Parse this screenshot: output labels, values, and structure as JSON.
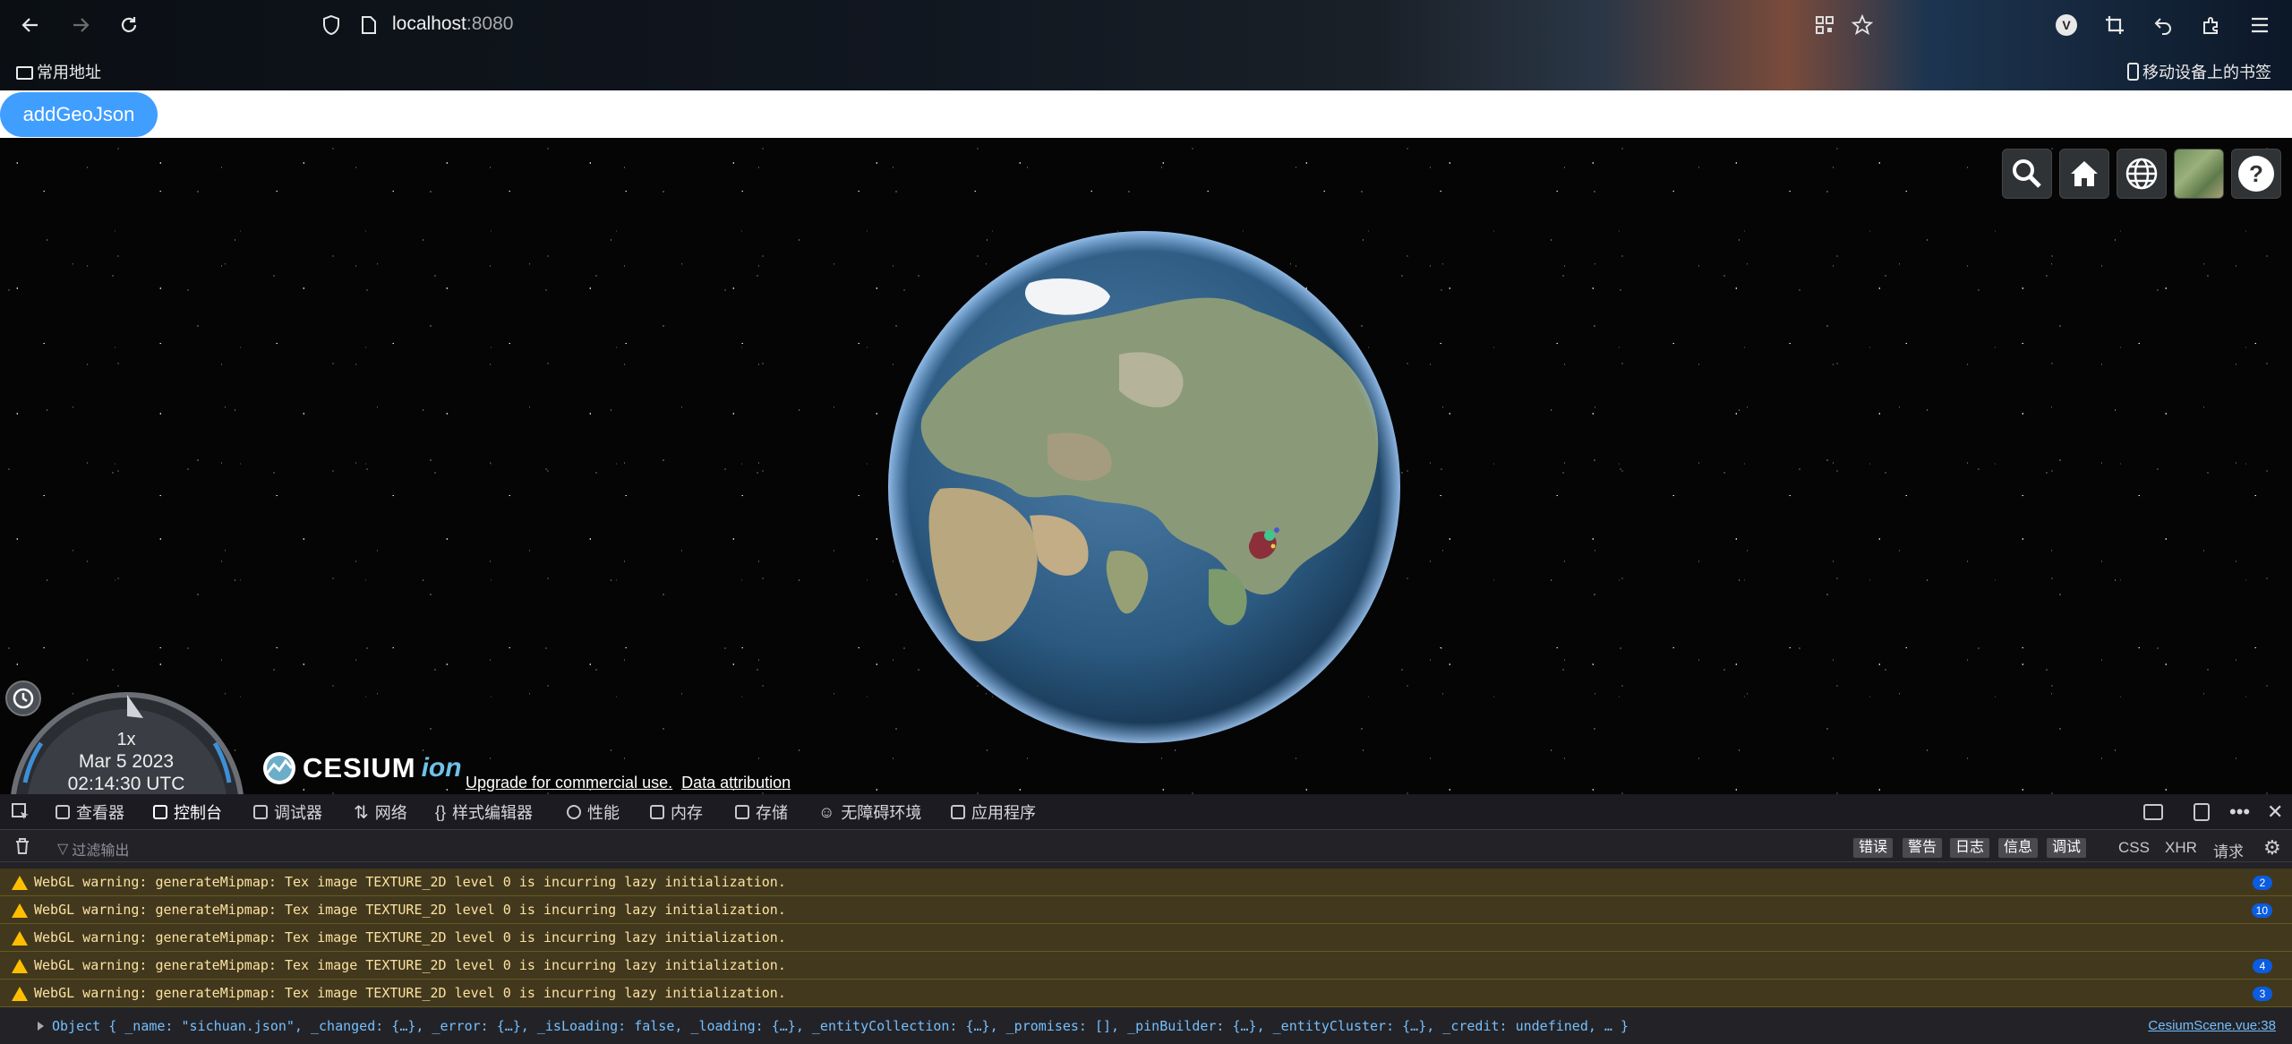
{
  "browser": {
    "url_host": "localhost",
    "url_port": ":8080",
    "bookmarks": {
      "left_folder": "常用地址",
      "right_folder": "移动设备上的书签"
    },
    "icons": [
      "back-arrow-icon",
      "forward-arrow-icon",
      "reload-icon",
      "shield-icon",
      "page-icon",
      "qr-code-icon",
      "star-icon",
      "vue-devtools-icon",
      "crop-icon",
      "undo-icon",
      "extensions-icon",
      "menu-icon"
    ]
  },
  "toolbar": {
    "add_geojson_label": "addGeoJson"
  },
  "cesium": {
    "toolbar_icons": [
      "search-icon",
      "home-icon",
      "globe-icon",
      "imagery-layer-icon",
      "help-icon"
    ],
    "animation": {
      "speed": "1x",
      "date": "Mar 5 2023",
      "time": "02:14:30 UTC"
    },
    "logo": {
      "brand": "CESIUM",
      "suffix": "ion"
    },
    "credits": {
      "upgrade": "Upgrade for commercial use.",
      "attribution": "Data attribution"
    }
  },
  "devtools": {
    "tabs": [
      "查看器",
      "控制台",
      "调试器",
      "网络",
      "样式编辑器",
      "性能",
      "内存",
      "存储",
      "无障碍环境",
      "应用程序"
    ],
    "active_tab": "控制台",
    "filter_placeholder": "过滤输出",
    "levels": [
      "错误",
      "警告",
      "日志",
      "信息",
      "调试"
    ],
    "extra_filters": [
      "CSS",
      "XHR",
      "请求"
    ],
    "messages": [
      {
        "text": "WebGL warning: generateMipmap: Tex image TEXTURE_2D level 0 is incurring lazy initialization.",
        "count": "2"
      },
      {
        "text": "WebGL warning: generateMipmap: Tex image TEXTURE_2D level 0 is incurring lazy initialization.",
        "count": "10"
      },
      {
        "text": "WebGL warning: generateMipmap: Tex image TEXTURE_2D level 0 is incurring lazy initialization.",
        "count": ""
      },
      {
        "text": "WebGL warning: generateMipmap: Tex image TEXTURE_2D level 0 is incurring lazy initialization.",
        "count": "4"
      },
      {
        "text": "WebGL warning: generateMipmap: Tex image TEXTURE_2D level 0 is incurring lazy initialization.",
        "count": "3"
      }
    ],
    "object_log": "Object { _name: \"sichuan.json\", _changed: {…}, _error: {…}, _isLoading: false, _loading: {…}, _entityCollection: {…}, _promises: [], _pinBuilder: {…}, _entityCluster: {…}, _credit: undefined, … }",
    "object_source": "CesiumScene.vue:38"
  }
}
